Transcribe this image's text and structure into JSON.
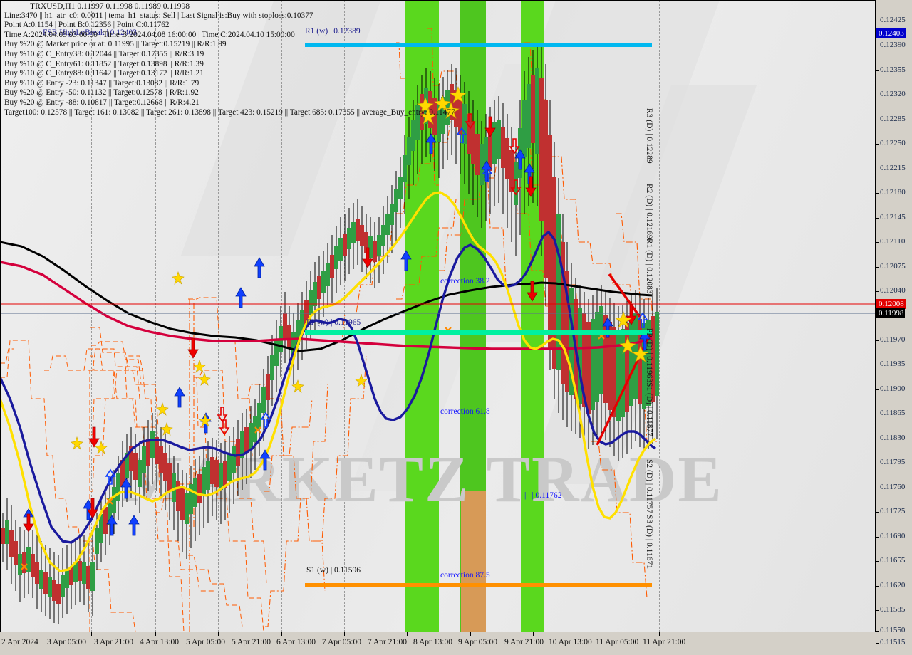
{
  "chart_data": {
    "type": "candlestick",
    "title": "TRXUSD,H1  0.11997 0.11998 0.11989 0.11998",
    "symbol": "TRXUSD",
    "timeframe": "H1",
    "ohlc": {
      "open": "0.11997",
      "high": "0.11998",
      "low": "0.11989",
      "close": "0.11998"
    },
    "ylabel": "",
    "xlabel": "",
    "ylim": [
      0.11515,
      0.12425
    ],
    "grid": true,
    "y_ticks": [
      "0.12425",
      "0.12390",
      "0.12355",
      "0.12320",
      "0.12285",
      "0.12250",
      "0.12215",
      "0.12180",
      "0.12145",
      "0.12110",
      "0.12075",
      "0.12040",
      "0.11970",
      "0.11935",
      "0.11900",
      "0.11865",
      "0.11830",
      "0.11795",
      "0.11760",
      "0.11725",
      "0.11690",
      "0.11655",
      "0.11620",
      "0.11585",
      "0.11550",
      "0.11515"
    ],
    "x_ticks": [
      "2 Apr 2024",
      "3 Apr 05:00",
      "3 Apr 21:00",
      "4 Apr 13:00",
      "5 Apr 05:00",
      "5 Apr 21:00",
      "6 Apr 13:00",
      "7 Apr 05:00",
      "7 Apr 21:00",
      "8 Apr 13:00",
      "9 Apr 05:00",
      "9 Apr 21:00",
      "10 Apr 13:00",
      "11 Apr 05:00",
      "11 Apr 21:00"
    ],
    "price_tags": [
      {
        "value": "0.12403",
        "color": "#0000cc",
        "text_color": "#ffffff"
      },
      {
        "value": "0.12008",
        "color": "#e00000",
        "text_color": "#ffffff"
      },
      {
        "value": "0.11998",
        "color": "#000000",
        "text_color": "#ffffff"
      }
    ],
    "levels": [
      {
        "name": "R1 (w)",
        "value": "0.12389",
        "label": "R1 (w) | 0.12389",
        "color": "#2020cc",
        "style": "dashed"
      },
      {
        "name": "FSB HighLoBreak",
        "value": "0.12403",
        "label": "FSB HighLoBreak | 0.12403",
        "color": "#00b8f0",
        "style": "solid"
      },
      {
        "name": "PP (w)",
        "value": "0.11965",
        "label": "PP (w) | 0.11965",
        "color": "#00f0a0",
        "style": "solid"
      },
      {
        "name": "S1 (w)",
        "value": "0.11596",
        "label": "S1 (w) | 0.11596",
        "color": "#ff9000",
        "style": "solid"
      }
    ],
    "pivots_daily": [
      {
        "label": "R3 (D) | 0.12289"
      },
      {
        "label": "R2 (D) | 0.12169"
      },
      {
        "label": "R1 (D) | 0.12083"
      },
      {
        "label": "PP (D) | 0.11963"
      },
      {
        "label": "S1 (D) | 0.11877"
      },
      {
        "label": "S2 (D) | 0.11757"
      },
      {
        "label": "S3 (D) | 0.11671"
      }
    ],
    "corrections": [
      {
        "label": "correction 38.2",
        "color": "#1414ff"
      },
      {
        "label": "correction 61.8",
        "color": "#1414ff"
      },
      {
        "label": "correction 87.5",
        "color": "#1414ff"
      },
      {
        "label": "| | | 0.11762",
        "color": "#1414ff"
      }
    ],
    "zones": [
      {
        "color": "#5ad81e",
        "note": "bullish session zone"
      },
      {
        "color": "#4cc425",
        "note": "bullish session zone"
      },
      {
        "color": "#5ad81e",
        "note": "bullish session zone"
      },
      {
        "color": "#5ad81e",
        "note": "bullish session zone"
      },
      {
        "color": "#d79a57",
        "note": "correction 87.5 zone"
      },
      {
        "color": "#5ad81e",
        "note": "bullish session zone"
      }
    ],
    "series": [
      {
        "name": "tema fast",
        "color": "#ffe000"
      },
      {
        "name": "tema slow",
        "color": "#1a1a9e"
      },
      {
        "name": "ema long",
        "color": "#000000"
      },
      {
        "name": "ema band",
        "color": "#d4003c"
      },
      {
        "name": "fractal channel",
        "color": "#ff5a00",
        "style": "dash-dot"
      }
    ]
  },
  "header": {
    "symbol_line": "TRXUSD,H1  0.11997 0.11998 0.11989 0.11998",
    "lines": [
      "Line:3470 || h1_atr_c0: 0.0011 | tema_h1_status: Sell | Last Signal is:Buy with stoploss:0.10377",
      "Point A:0.1154 | Point B:0.12356 | Point C:0.11762",
      "Time A:2024.04.03 03:00:00 | Time B:2024.04.08 16:00:00 | Time C:2024.04.10 15:00:00",
      "Buy %20 @ Market price or at: 0.11995 || Target:0.15219 || R/R:1.99",
      "Buy %10 @ C_Entry38: 0.12044 || Target:0.17355 || R/R:3.19",
      "Buy %10 @ C_Entry61: 0.11852 || Target:0.13898 || R/R:1.39",
      "Buy %10 @ C_Entry88: 0.11642 || Target:0.13172 || R/R:1.21",
      "Buy %10 @ Entry -23: 0.11347 || Target:0.13082 || R/R:1.79",
      "Buy %20 @ Entry -50: 0.11132 || Target:0.12578 || R/R:1.92",
      "Buy %20 @ Entry -88: 0.10817 || Target:0.12668 || R/R:4.21",
      "Target100: 0.12578 || Target 161: 0.13082 || Target 261: 0.13898 || Target 423: 0.15219 || Target 685: 0.17355 || average_Buy_entry: 0.11477"
    ]
  },
  "watermark": {
    "text": "MARKETZ TRADE"
  }
}
